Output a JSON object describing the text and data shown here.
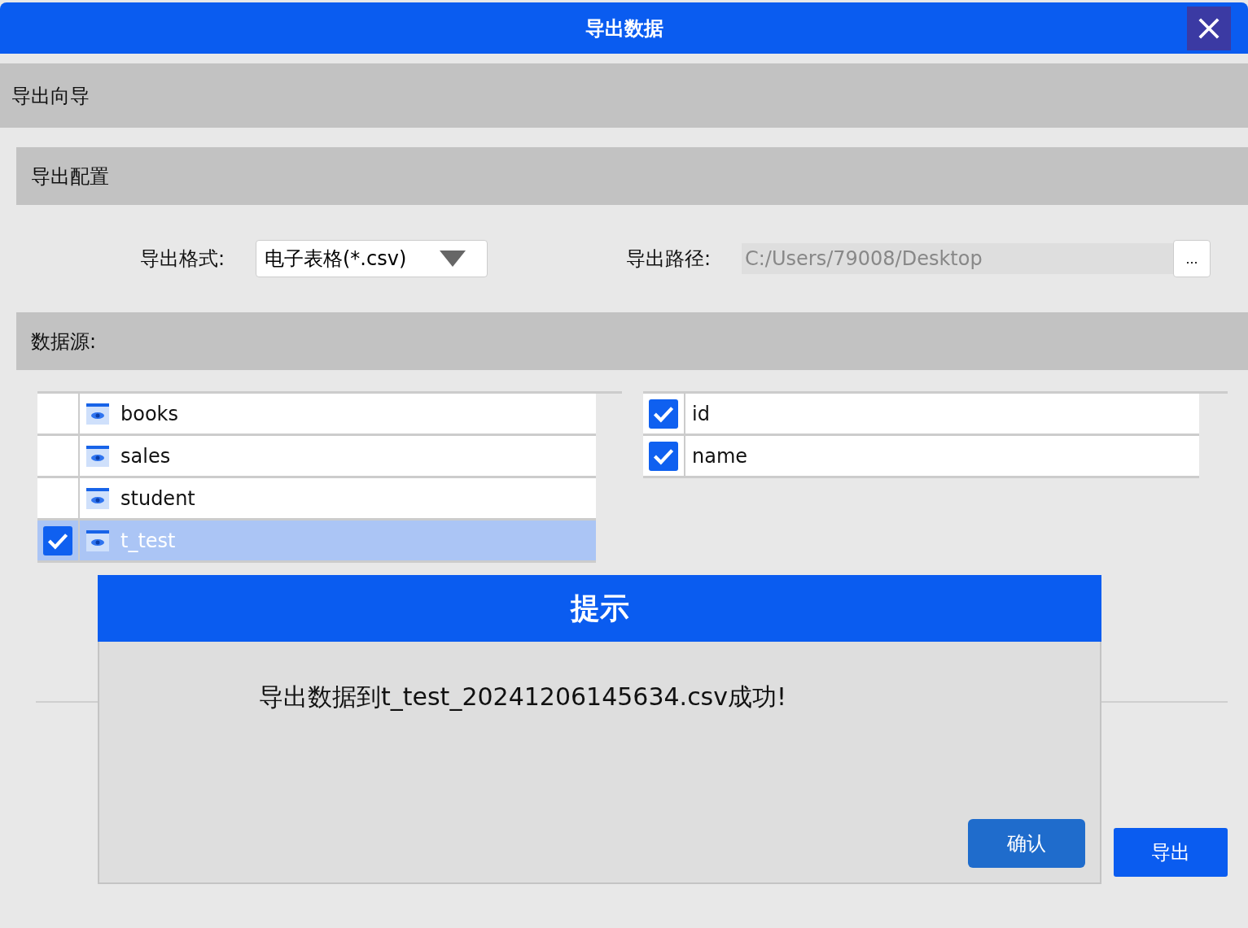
{
  "window": {
    "title": "导出数据"
  },
  "wizard": {
    "title": "导出向导"
  },
  "config": {
    "title": "导出配置",
    "format_label": "导出格式:",
    "format_value": "电子表格(*.csv)",
    "path_label": "导出路径:",
    "path_value": "C:/Users/79008/Desktop",
    "browse_button": "..."
  },
  "source": {
    "title": "数据源:"
  },
  "tables": [
    {
      "name": "books",
      "checked": false,
      "selected": false
    },
    {
      "name": "sales",
      "checked": false,
      "selected": false
    },
    {
      "name": "student",
      "checked": false,
      "selected": false
    },
    {
      "name": "t_test",
      "checked": true,
      "selected": true
    }
  ],
  "columns": [
    {
      "name": "id",
      "checked": true
    },
    {
      "name": "name",
      "checked": true
    }
  ],
  "export_button": "导出",
  "message_box": {
    "title": "提示",
    "message": "导出数据到t_test_20241206145634.csv成功!",
    "confirm_button": "确认"
  }
}
